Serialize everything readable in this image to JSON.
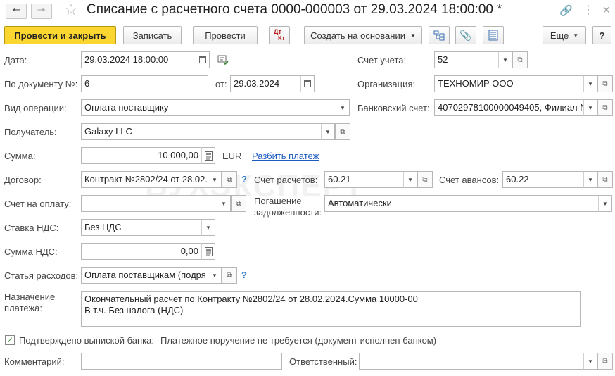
{
  "window": {
    "title": "Списание с расчетного счета 0000-000003 от 29.03.2024 18:00:00 *"
  },
  "toolbar": {
    "post_close": "Провести и закрыть",
    "save": "Записать",
    "post": "Провести",
    "dt_label": "Дт",
    "kt_label": "Кт",
    "create_based": "Создать на основании",
    "more": "Еще",
    "help": "?"
  },
  "form": {
    "date_label": "Дата:",
    "date_value": "29.03.2024 18:00:00",
    "docnum_label": "По документу №:",
    "docnum_value": "6",
    "from_label": "от:",
    "from_value": "29.03.2024",
    "operation_label": "Вид операции:",
    "operation_value": "Оплата поставщику",
    "recipient_label": "Получатель:",
    "recipient_value": "Galaxy LLC",
    "sum_label": "Сумма:",
    "sum_value": "10 000,00",
    "currency": "EUR",
    "split_link": "Разбить платеж",
    "contract_label": "Договор:",
    "contract_value": "Контракт №2802/24 от 28.02.",
    "invoice_label": "Счет на оплату:",
    "invoice_value": "",
    "vat_rate_label": "Ставка НДС:",
    "vat_rate_value": "Без НДС",
    "vat_sum_label": "Сумма НДС:",
    "vat_sum_value": "0,00",
    "expense_label": "Статья расходов:",
    "expense_value": "Оплата поставщикам (подря",
    "purpose_label_1": "Назначение",
    "purpose_label_2": "платежа:",
    "purpose_line_1": "Окончательный расчет по Контракту №2802/24 от 28.02.2024.Сумма 10000-00",
    "purpose_line_2": "В т.ч. Без налога (НДС)",
    "confirmed_label": "Подтверждено выпиской банка:",
    "confirmed_note": "Платежное поручение не требуется (документ исполнен банком)",
    "comment_label": "Комментарий:",
    "comment_value": "",
    "responsible_label": "Ответственный:",
    "responsible_value": "",
    "account_label": "Счет учета:",
    "account_value": "52",
    "org_label": "Организация:",
    "org_value": "ТЕХНОМИР ООО",
    "bank_label": "Банковский счет:",
    "bank_value": "40702978100000049405, Филиал N",
    "settle_label": "Счет расчетов:",
    "settle_value": "60.21",
    "advance_label": "Счет авансов:",
    "advance_value": "60.22",
    "debt_label_1": "Погашение",
    "debt_label_2": "задолженности:",
    "debt_value": "Автоматически",
    "help_q": "?"
  },
  "watermark": "БУХЭКСПЕРТ"
}
